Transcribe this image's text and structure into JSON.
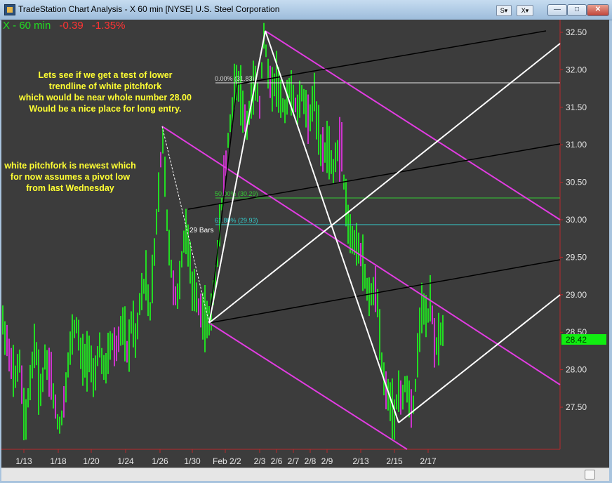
{
  "window": {
    "title": "TradeStation Chart Analysis - X 60 min [NYSE] U.S. Steel Corporation",
    "style_btn_label": "S",
    "format_btn_label": "X"
  },
  "chart": {
    "symbol_label": "X - 60 min",
    "change": "-0.39",
    "change_pct": "-1.35%",
    "last_price": "28.42",
    "annotation_lines": [
      "Lets see if we get a test of lower",
      "trendline of white pitchfork",
      "which would be near whole number 28.00",
      "Would be a nice place for long entry."
    ],
    "annotation2_lines": [
      "white pitchfork is newest which",
      "for now assumes a pivot low",
      "from last Wednesday"
    ],
    "bars_label": "29 Bars",
    "fib_labels": [
      "0.00% (31.83)",
      "50.00% (30.29)",
      "61.80% (29.93)"
    ],
    "fib_levels": [
      31.83,
      30.29,
      29.93
    ],
    "colors": {
      "up": "#22dd22",
      "down": "#cc33cc",
      "pitchfork_white": "#ffffff",
      "pitchfork_magenta": "#e23ce2",
      "pitchfork_black": "#000000",
      "annotation": "#ffff33",
      "fib_50": "#33cc33",
      "fib_618": "#33cccc",
      "price_tag": "#11ee11"
    }
  },
  "chart_data": {
    "type": "bar",
    "ylim": [
      27.0,
      32.75
    ],
    "y_ticks": [
      "32.50",
      "32.00",
      "31.50",
      "31.00",
      "30.50",
      "30.00",
      "29.50",
      "29.00",
      "28.50",
      "28.00",
      "27.50"
    ],
    "x_ticks": [
      "1/13",
      "1/18",
      "1/20",
      "1/24",
      "1/26",
      "1/30",
      "Feb 2/2",
      "2/3",
      "2/6",
      "2/7",
      "2/8",
      "2/9",
      "2/13",
      "2/15",
      "2/17"
    ],
    "path_points": [
      [
        0,
        28.7
      ],
      [
        10,
        28.3
      ],
      [
        18,
        27.8
      ],
      [
        25,
        28.2
      ],
      [
        34,
        27.3
      ],
      [
        42,
        27.9
      ],
      [
        48,
        28.4
      ],
      [
        55,
        27.6
      ],
      [
        62,
        28.1
      ],
      [
        70,
        27.9
      ],
      [
        78,
        27.4
      ],
      [
        84,
        27.2
      ],
      [
        92,
        27.8
      ],
      [
        100,
        28.4
      ],
      [
        108,
        28.6
      ],
      [
        116,
        28.1
      ],
      [
        124,
        28.2
      ],
      [
        132,
        27.9
      ],
      [
        140,
        28.3
      ],
      [
        148,
        27.9
      ],
      [
        156,
        28.4
      ],
      [
        164,
        28.3
      ],
      [
        172,
        28.6
      ],
      [
        180,
        28.2
      ],
      [
        186,
        28.7
      ],
      [
        192,
        28.4
      ],
      [
        198,
        29.0
      ],
      [
        206,
        29.2
      ],
      [
        212,
        28.8
      ],
      [
        218,
        29.6
      ],
      [
        222,
        30.1
      ],
      [
        226,
        30.6
      ],
      [
        229,
        31.2
      ],
      [
        233,
        30.6
      ],
      [
        238,
        29.6
      ],
      [
        244,
        29.2
      ],
      [
        250,
        28.9
      ],
      [
        256,
        29.4
      ],
      [
        262,
        29.9
      ],
      [
        268,
        29.6
      ],
      [
        272,
        29.1
      ],
      [
        278,
        28.9
      ],
      [
        284,
        28.8
      ],
      [
        290,
        28.7
      ],
      [
        296,
        28.6
      ],
      [
        302,
        29.0
      ],
      [
        308,
        29.6
      ],
      [
        314,
        30.2
      ],
      [
        318,
        30.6
      ],
      [
        322,
        31.0
      ],
      [
        326,
        31.3
      ],
      [
        332,
        31.7
      ],
      [
        338,
        31.8
      ],
      [
        344,
        31.5
      ],
      [
        350,
        31.3
      ],
      [
        356,
        31.6
      ],
      [
        362,
        31.9
      ],
      [
        368,
        31.5
      ],
      [
        374,
        32.5
      ],
      [
        380,
        32.0
      ],
      [
        386,
        31.7
      ],
      [
        392,
        31.9
      ],
      [
        398,
        31.6
      ],
      [
        404,
        31.5
      ],
      [
        410,
        31.8
      ],
      [
        416,
        31.6
      ],
      [
        422,
        31.5
      ],
      [
        428,
        31.7
      ],
      [
        434,
        31.5
      ],
      [
        440,
        31.4
      ],
      [
        446,
        31.7
      ],
      [
        450,
        31.3
      ],
      [
        456,
        30.9
      ],
      [
        460,
        30.9
      ],
      [
        466,
        31.0
      ],
      [
        472,
        30.6
      ],
      [
        478,
        30.9
      ],
      [
        484,
        31.0
      ],
      [
        490,
        30.2
      ],
      [
        496,
        29.8
      ],
      [
        502,
        29.7
      ],
      [
        508,
        29.6
      ],
      [
        514,
        29.5
      ],
      [
        520,
        29.1
      ],
      [
        526,
        29.0
      ],
      [
        532,
        29.1
      ],
      [
        536,
        28.9
      ],
      [
        540,
        28.4
      ],
      [
        544,
        27.9
      ],
      [
        548,
        27.7
      ],
      [
        552,
        27.6
      ],
      [
        556,
        27.5
      ],
      [
        560,
        27.4
      ],
      [
        566,
        27.8
      ],
      [
        570,
        27.6
      ],
      [
        576,
        27.8
      ],
      [
        582,
        27.5
      ],
      [
        586,
        27.4
      ],
      [
        592,
        28.0
      ],
      [
        596,
        28.6
      ],
      [
        602,
        28.8
      ],
      [
        608,
        28.7
      ],
      [
        612,
        28.9
      ],
      [
        616,
        28.5
      ],
      [
        620,
        28.3
      ],
      [
        624,
        28.4
      ],
      [
        628,
        28.6
      ]
    ]
  }
}
